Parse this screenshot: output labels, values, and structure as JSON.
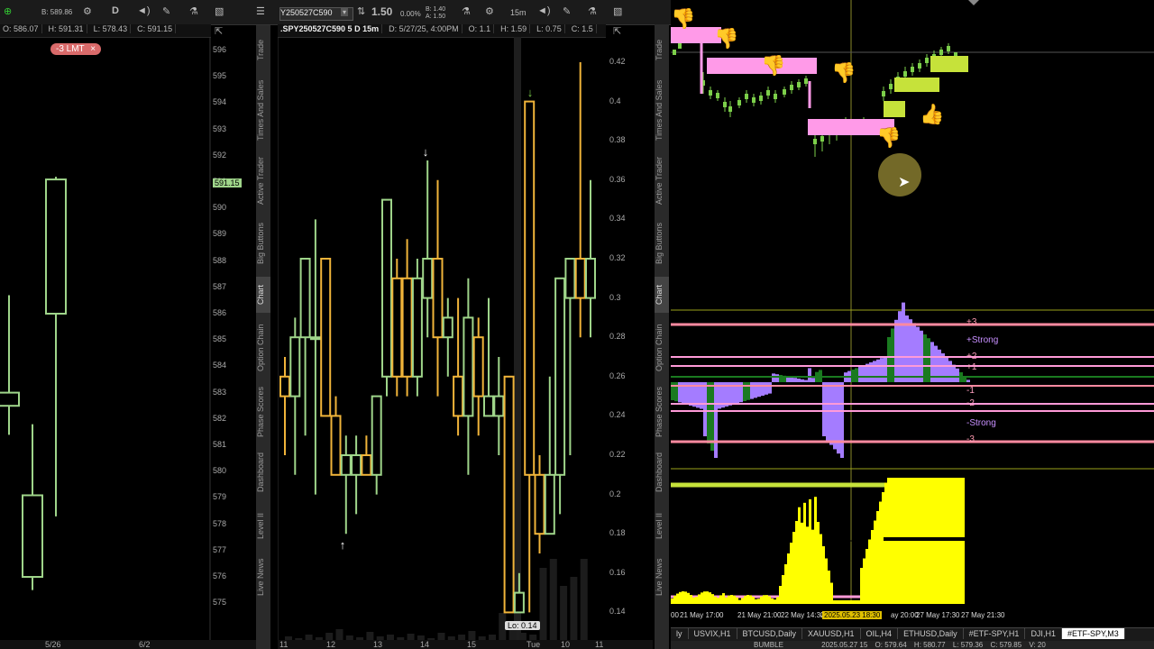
{
  "left_chart": {
    "toolbar": {
      "price_top": "B: 589.86",
      "d_btn": "D"
    },
    "ohlc": {
      "open": "O: 586.07",
      "high": "H: 591.31",
      "low": "L: 578.43",
      "close": "C: 591.15"
    },
    "order_badge": "-3 LMT",
    "order_close": "×",
    "current_price": "591.15",
    "price_axis": [
      "596",
      "595",
      "594",
      "593",
      "592",
      "591",
      "590",
      "589",
      "588",
      "587",
      "586",
      "585",
      "584",
      "583",
      "582",
      "581",
      "580",
      "579",
      "578",
      "577",
      "576",
      "575"
    ],
    "x_labels": [
      "5/26",
      "6/2"
    ],
    "candles": [
      {
        "o": 583,
        "h": 586.7,
        "l": 581.4,
        "c": 582.5
      },
      {
        "o": 576,
        "h": 581.8,
        "l": 575.5,
        "c": 579.1
      },
      {
        "o": 586,
        "h": 591.2,
        "l": 578.3,
        "c": 591.1
      }
    ]
  },
  "middle_chart": {
    "toolbar": {
      "symbol": "Y250527C590",
      "price": "1.50",
      "change": "0.00%",
      "bid": "B: 1.40",
      "ask": "A: 1.50",
      "interval": "15m"
    },
    "header": {
      "title": ".SPY250527C590 5 D 15m",
      "date": "D: 5/27/25, 4:00PM",
      "open": "O: 1.1",
      "high": "H: 1.59",
      "low": "L: 0.75",
      "close": "C: 1.5"
    },
    "price_axis": [
      "0.42",
      "0.4",
      "0.38",
      "0.36",
      "0.34",
      "0.32",
      "0.3",
      "0.28",
      "0.26",
      "0.24",
      "0.22",
      "0.2",
      "0.18",
      "0.16",
      "0.14"
    ],
    "x_labels": [
      "11",
      "12",
      "13",
      "14",
      "15",
      "Tue",
      "10",
      "11"
    ],
    "low_badge": "Lo: 0.14",
    "candles": [
      {
        "o": 0.26,
        "h": 0.27,
        "l": 0.22,
        "c": 0.25,
        "up": false
      },
      {
        "o": 0.25,
        "h": 0.29,
        "l": 0.21,
        "c": 0.28,
        "up": true
      },
      {
        "o": 0.28,
        "h": 0.32,
        "l": 0.23,
        "c": 0.32,
        "up": true
      },
      {
        "o": 0.28,
        "h": 0.34,
        "l": 0.2,
        "c": 0.28,
        "up": true
      },
      {
        "o": 0.32,
        "h": 0.32,
        "l": 0.24,
        "c": 0.24,
        "up": false
      },
      {
        "o": 0.24,
        "h": 0.25,
        "l": 0.21,
        "c": 0.21,
        "up": false
      },
      {
        "o": 0.21,
        "h": 0.23,
        "l": 0.18,
        "c": 0.22,
        "up": true
      },
      {
        "o": 0.21,
        "h": 0.23,
        "l": 0.19,
        "c": 0.22,
        "up": true
      },
      {
        "o": 0.22,
        "h": 0.23,
        "l": 0.21,
        "c": 0.21,
        "up": false
      },
      {
        "o": 0.21,
        "h": 0.25,
        "l": 0.2,
        "c": 0.25,
        "up": true
      },
      {
        "o": 0.26,
        "h": 0.35,
        "l": 0.25,
        "c": 0.35,
        "up": true
      },
      {
        "o": 0.31,
        "h": 0.32,
        "l": 0.25,
        "c": 0.26,
        "up": false
      },
      {
        "o": 0.31,
        "h": 0.33,
        "l": 0.25,
        "c": 0.26,
        "up": false
      },
      {
        "o": 0.26,
        "h": 0.32,
        "l": 0.25,
        "c": 0.31,
        "up": true
      },
      {
        "o": 0.3,
        "h": 0.37,
        "l": 0.28,
        "c": 0.32,
        "up": true
      },
      {
        "o": 0.32,
        "h": 0.36,
        "l": 0.25,
        "c": 0.28,
        "up": false
      },
      {
        "o": 0.28,
        "h": 0.3,
        "l": 0.26,
        "c": 0.29,
        "up": true
      },
      {
        "o": 0.26,
        "h": 0.3,
        "l": 0.23,
        "c": 0.24,
        "up": false
      },
      {
        "o": 0.24,
        "h": 0.31,
        "l": 0.21,
        "c": 0.29,
        "up": true
      },
      {
        "o": 0.28,
        "h": 0.29,
        "l": 0.23,
        "c": 0.25,
        "up": false
      },
      {
        "o": 0.25,
        "h": 0.3,
        "l": 0.24,
        "c": 0.24,
        "up": true
      },
      {
        "o": 0.25,
        "h": 0.27,
        "l": 0.22,
        "c": 0.24,
        "up": true
      },
      {
        "o": 0.26,
        "h": 0.26,
        "l": 0.14,
        "c": 0.14,
        "up": false
      },
      {
        "o": 0.14,
        "h": 0.16,
        "l": 0.14,
        "c": 0.15,
        "up": true
      },
      {
        "o": 0.4,
        "h": 0.4,
        "l": 0.14,
        "c": 0.21,
        "up": false
      },
      {
        "o": 0.21,
        "h": 0.22,
        "l": 0.17,
        "c": 0.18,
        "up": false
      },
      {
        "o": 0.18,
        "h": 0.26,
        "l": 0.18,
        "c": 0.21,
        "up": true
      },
      {
        "o": 0.21,
        "h": 0.31,
        "l": 0.19,
        "c": 0.31,
        "up": true
      },
      {
        "o": 0.3,
        "h": 0.32,
        "l": 0.22,
        "c": 0.32,
        "up": true
      },
      {
        "o": 0.32,
        "h": 0.42,
        "l": 0.28,
        "c": 0.3,
        "up": false
      },
      {
        "o": 0.3,
        "h": 0.36,
        "l": 0.28,
        "c": 0.32,
        "up": true
      }
    ]
  },
  "side_tabs": [
    "Trade",
    "Times And Sales",
    "Active Trader",
    "Big Buttons",
    "Chart",
    "Option Chain",
    "Phase Scores",
    "Dashboard",
    "Level II",
    "Live News"
  ],
  "side_tabs_active": "Chart",
  "right_chart": {
    "levels": [
      {
        "label": "+3",
        "color": "#ff9ab0"
      },
      {
        "label": "+Strong",
        "color": "#c890ff"
      },
      {
        "label": "+2",
        "color": "#ffa0c0"
      },
      {
        "label": "+1",
        "color": "#ffa0c0"
      },
      {
        "label": "-1",
        "color": "#ffa0c0"
      },
      {
        "label": "-2",
        "color": "#ffa0c0"
      },
      {
        "label": "-Strong",
        "color": "#c890ff"
      },
      {
        "label": "-3",
        "color": "#ff9ab0"
      }
    ],
    "x_labels": [
      "00",
      "21 May 17:00",
      "21 May 21:00",
      "22 May 14:30",
      "22 May 18:30",
      "2025.05.23 18:30",
      "ay 20:00",
      "27 May 17:30",
      "27 May 21:30"
    ],
    "x_highlight": "2025.05.23 18:30",
    "tabs": [
      "ly",
      "USVIX,H1",
      "BTCUSD,Daily",
      "XAUUSD,H1",
      "OIL,H4",
      "ETHUSD,Daily",
      "#ETF-SPY,H1",
      "DJI,H1",
      "#ETF-SPY,M3"
    ],
    "active_tab": "#ETF-SPY,M3",
    "status_left": "BUMBLE",
    "status_date": "2025.05.27 15",
    "status_o": "O: 579.64",
    "status_h": "H: 580.77",
    "status_l": "L: 579.36",
    "status_c": "C: 579.85",
    "status_v": "V: 20"
  },
  "colors": {
    "up": "#9fd58a",
    "down": "#f0b43a",
    "pink": "#ff9ae8",
    "lime": "#c6e23a",
    "purple": "#a47cff",
    "green": "#1a7a20",
    "yellow": "#ffff00"
  }
}
